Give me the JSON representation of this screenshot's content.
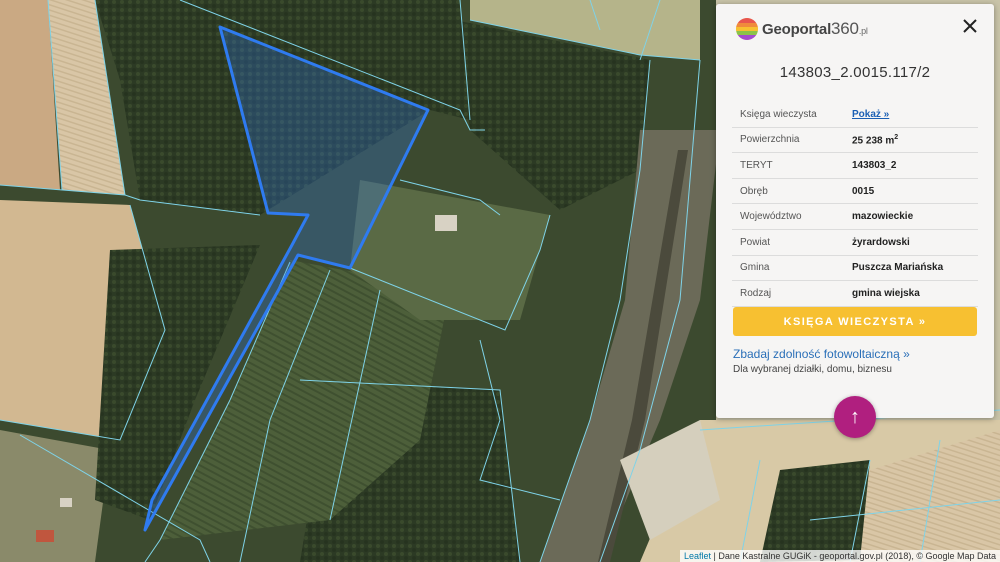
{
  "logo": {
    "brand": "Geoportal",
    "num": "360",
    "domain": ".pl"
  },
  "panel": {
    "title": "143803_2.0015.117/2",
    "rows": [
      {
        "label": "Księga wieczysta",
        "value": "Pokaż »"
      },
      {
        "label": "Powierzchnia",
        "value": "25 238 m",
        "sup": "2"
      },
      {
        "label": "TERYT",
        "value": "143803_2"
      },
      {
        "label": "Obręb",
        "value": "0015"
      },
      {
        "label": "Województwo",
        "value": "mazowieckie"
      },
      {
        "label": "Powiat",
        "value": "żyrardowski"
      },
      {
        "label": "Gmina",
        "value": "Puszcza Mariańska"
      },
      {
        "label": "Rodzaj",
        "value": "gmina wiejska"
      }
    ],
    "cta": "KSIĘGA WIECZYSTA »",
    "pv_link": "Zbadaj zdolność fotowoltaiczną »",
    "pv_sub": "Dla wybranej działki, domu, biznesu"
  },
  "up_button": "↑",
  "attribution": {
    "leaflet": "Leaflet",
    "rest": " | Dane Kastralne GUGiK - geoportal.gov.pl (2018), © Google Map Data"
  },
  "colors": {
    "parcel": "#2f7bf0",
    "boundary": "#7fd3e8",
    "cta": "#f7c031",
    "fab": "#b01f7f"
  }
}
